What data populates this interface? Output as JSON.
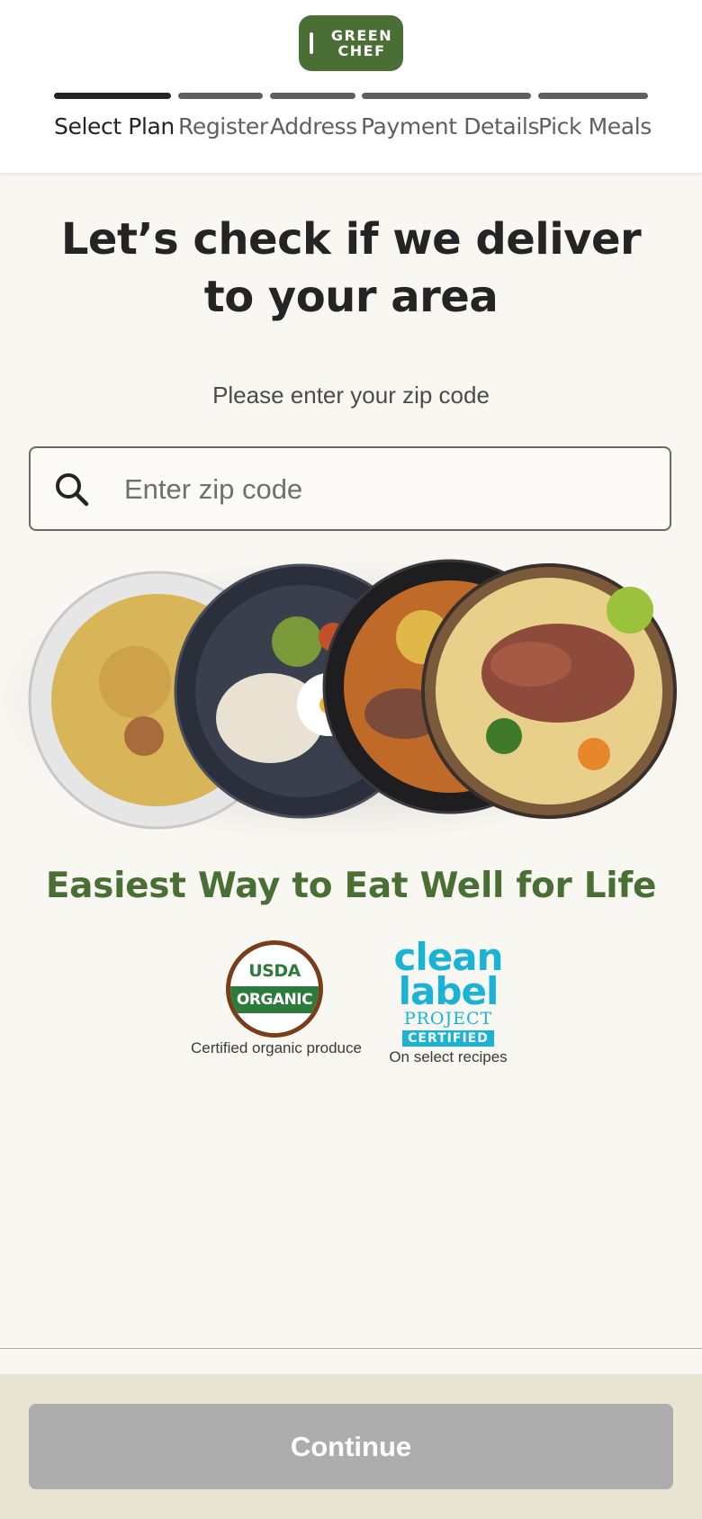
{
  "brand": {
    "line1": "GREEN",
    "line2": "CHEF",
    "color": "#4a6f35"
  },
  "steps": [
    {
      "label": "Select Plan",
      "active": true
    },
    {
      "label": "Register",
      "active": false
    },
    {
      "label": "Address",
      "active": false
    },
    {
      "label": "Payment Details",
      "active": false
    },
    {
      "label": "Pick Meals",
      "active": false
    }
  ],
  "main": {
    "title": "Let’s check if we deliver to your area",
    "subtitle": "Please enter your zip code",
    "zip": {
      "placeholder": "Enter zip code",
      "value": "",
      "icon": "search-icon"
    },
    "tagline": "Easiest Way to Eat Well for Life"
  },
  "badges": {
    "usda": {
      "top": "USDA",
      "band": "ORGANIC",
      "caption": "Certified organic produce"
    },
    "clean": {
      "line1": "clean",
      "line2": "label",
      "project": "PROJECT",
      "certified": "CERTIFIED",
      "caption": "On select recipes"
    }
  },
  "footer": {
    "continue_label": "Continue"
  },
  "colors": {
    "accent": "#4a6f35",
    "background": "#f9f7f1",
    "disabled_button": "#adadad",
    "clean_label": "#1ab3d6"
  }
}
